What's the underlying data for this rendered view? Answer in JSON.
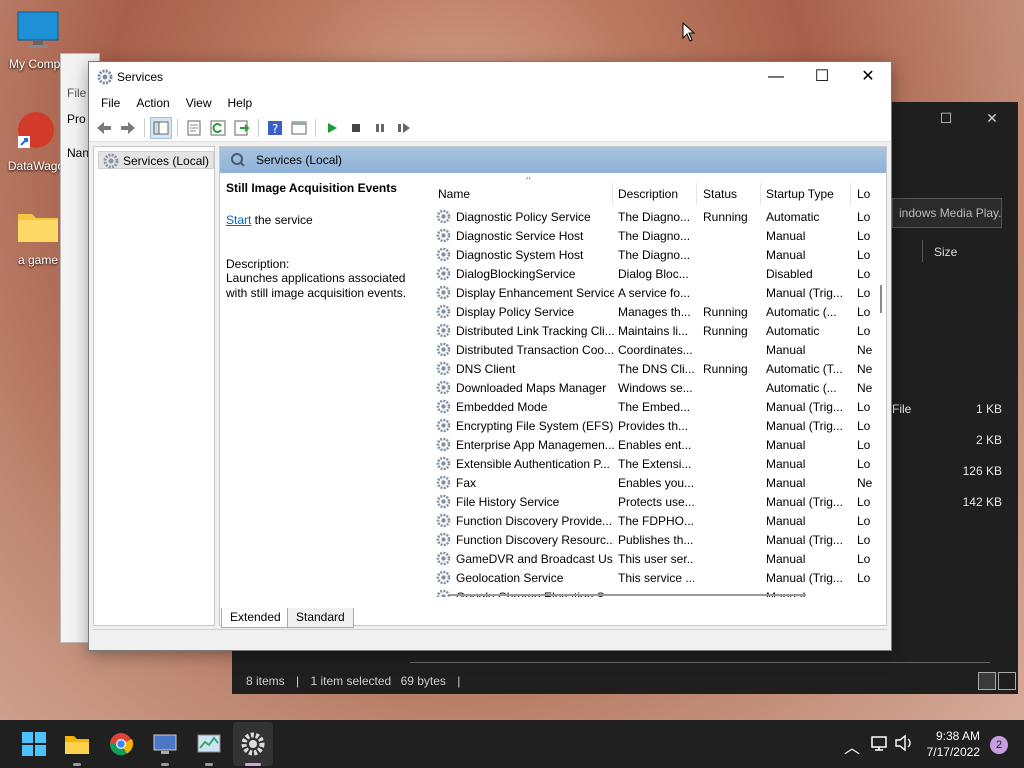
{
  "desktop": {
    "icons": [
      {
        "label": "My Compu"
      },
      {
        "label": "DataWago"
      },
      {
        "label": "a game"
      }
    ]
  },
  "explorer": {
    "search_text": "indows Media Play...",
    "col_size": "Size",
    "rows": [
      {
        "name": "n File",
        "size": "1 KB"
      },
      {
        "name": "",
        "size": "2 KB"
      },
      {
        "name": "",
        "size": "126 KB"
      },
      {
        "name": "",
        "size": "142 KB"
      }
    ],
    "status": {
      "items": "8 items",
      "selected": "1 item selected",
      "bytes": "69 bytes"
    }
  },
  "bgwin": {
    "file": "File",
    "pro": "Pro",
    "nam": "Nan"
  },
  "services": {
    "window_title": "Services",
    "menu": [
      "File",
      "Action",
      "View",
      "Help"
    ],
    "tree_node": "Services (Local)",
    "header_title": "Services (Local)",
    "detail": {
      "service_name": "Still Image Acquisition Events",
      "start_link": "Start",
      "start_suffix": " the service",
      "desc_label": "Description:",
      "desc_text": "Launches applications associated with still image acquisition events."
    },
    "columns": [
      "Name",
      "Description",
      "Status",
      "Startup Type",
      "Lo"
    ],
    "rows": [
      [
        "Diagnostic Policy Service",
        "The Diagno...",
        "Running",
        "Automatic",
        "Lo"
      ],
      [
        "Diagnostic Service Host",
        "The Diagno...",
        "",
        "Manual",
        "Lo"
      ],
      [
        "Diagnostic System Host",
        "The Diagno...",
        "",
        "Manual",
        "Lo"
      ],
      [
        "DialogBlockingService",
        "Dialog Bloc...",
        "",
        "Disabled",
        "Lo"
      ],
      [
        "Display Enhancement Service",
        "A service fo...",
        "",
        "Manual (Trig...",
        "Lo"
      ],
      [
        "Display Policy Service",
        "Manages th...",
        "Running",
        "Automatic (...",
        "Lo"
      ],
      [
        "Distributed Link Tracking Cli...",
        "Maintains li...",
        "Running",
        "Automatic",
        "Lo"
      ],
      [
        "Distributed Transaction Coo...",
        "Coordinates...",
        "",
        "Manual",
        "Ne"
      ],
      [
        "DNS Client",
        "The DNS Cli...",
        "Running",
        "Automatic (T...",
        "Ne"
      ],
      [
        "Downloaded Maps Manager",
        "Windows se...",
        "",
        "Automatic (...",
        "Ne"
      ],
      [
        "Embedded Mode",
        "The Embed...",
        "",
        "Manual (Trig...",
        "Lo"
      ],
      [
        "Encrypting File System (EFS)",
        "Provides th...",
        "",
        "Manual (Trig...",
        "Lo"
      ],
      [
        "Enterprise App Managemen...",
        "Enables ent...",
        "",
        "Manual",
        "Lo"
      ],
      [
        "Extensible Authentication P...",
        "The Extensi...",
        "",
        "Manual",
        "Lo"
      ],
      [
        "Fax",
        "Enables you...",
        "",
        "Manual",
        "Ne"
      ],
      [
        "File History Service",
        "Protects use...",
        "",
        "Manual (Trig...",
        "Lo"
      ],
      [
        "Function Discovery Provide...",
        "The FDPHO...",
        "",
        "Manual",
        "Lo"
      ],
      [
        "Function Discovery Resourc...",
        "Publishes th...",
        "",
        "Manual (Trig...",
        "Lo"
      ],
      [
        "GameDVR and Broadcast Us...",
        "This user ser...",
        "",
        "Manual",
        "Lo"
      ],
      [
        "Geolocation Service",
        "This service ...",
        "",
        "Manual (Trig...",
        "Lo"
      ],
      [
        "Google Chrome Elevation S...",
        "",
        "",
        "Manual",
        ""
      ]
    ],
    "tabs": [
      "Extended",
      "Standard"
    ]
  },
  "taskbar": {
    "time": "9:38 AM",
    "date": "7/17/2022",
    "notifications": "2"
  },
  "colors": {
    "accent_header": "#8eb1d6",
    "link": "#0066cc",
    "taskbar": "#202020"
  }
}
